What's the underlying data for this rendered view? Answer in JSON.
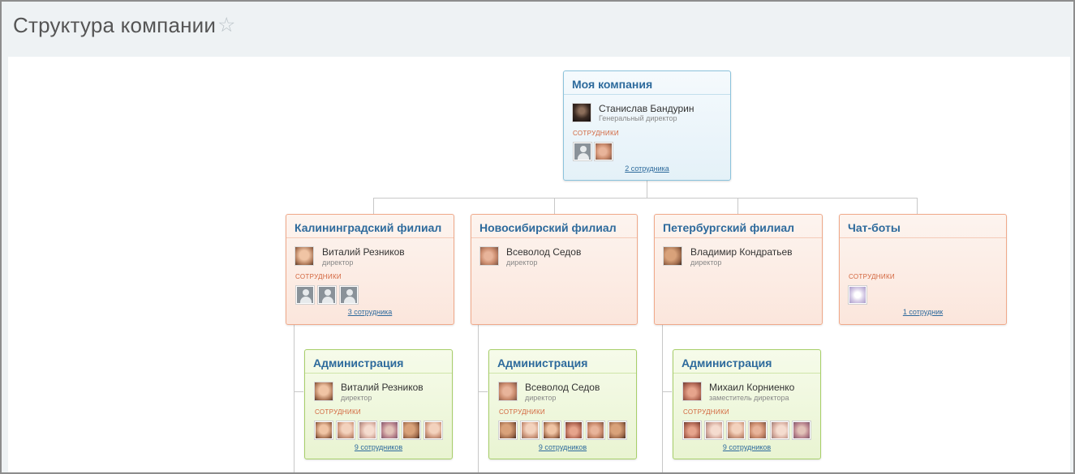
{
  "page": {
    "title": "Структура компании",
    "favorite_icon": "star-outline-icon"
  },
  "colors": {
    "blue_border": "#8cc3dc",
    "orange_border": "#f0a98a",
    "green_border": "#a8cf6a",
    "title_link": "#2d6a9c",
    "employees_label": "#d2643c"
  },
  "employees_label": "СОТРУДНИКИ",
  "root": {
    "title": "Моя компания",
    "head_name": "Станислав Бандурин",
    "head_role": "Генеральный директор",
    "count": "2 сотрудника"
  },
  "branches": [
    {
      "title": "Калининградский филиал",
      "head_name": "Виталий Резников",
      "head_role": "директор",
      "count": "3 сотрудника"
    },
    {
      "title": "Новосибирский филиал",
      "head_name": "Всеволод Седов",
      "head_role": "директор",
      "count": ""
    },
    {
      "title": "Петербургский филиал",
      "head_name": "Владимир Кондратьев",
      "head_role": "директор",
      "count": ""
    },
    {
      "title": "Чат-боты",
      "head_name": "",
      "head_role": "",
      "count": "1 сотрудник"
    }
  ],
  "departments": [
    {
      "title": "Администрация",
      "head_name": "Виталий Резников",
      "head_role": "директор",
      "count": "9 сотрудников"
    },
    {
      "title": "Администрация",
      "head_name": "Всеволод Седов",
      "head_role": "директор",
      "count": "9 сотрудников"
    },
    {
      "title": "Администрация",
      "head_name": "Михаил Корниенко",
      "head_role": "заместитель директора",
      "count": "9 сотрудников"
    }
  ]
}
